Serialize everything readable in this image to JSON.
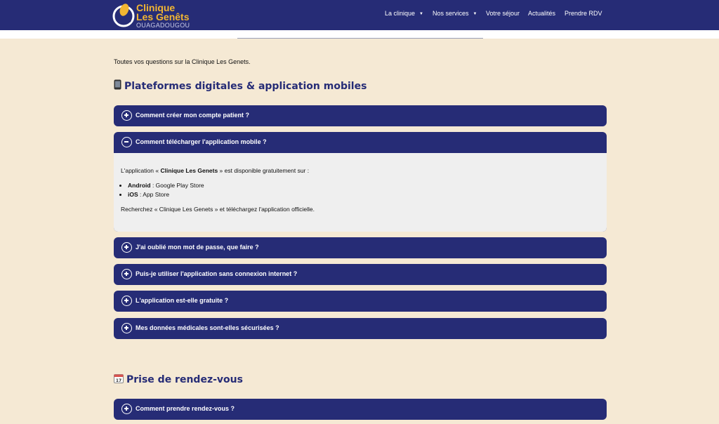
{
  "header": {
    "logo_line1": "Clinique",
    "logo_line2": "Les Genêts",
    "logo_line3": "OUAGADOUGOU",
    "nav": [
      {
        "label": "La clinique",
        "has_dropdown": true
      },
      {
        "label": "Nos services",
        "has_dropdown": true
      },
      {
        "label": "Votre séjour",
        "has_dropdown": false
      },
      {
        "label": "Actualités",
        "has_dropdown": false
      },
      {
        "label": "Prendre RDV",
        "has_dropdown": false
      }
    ]
  },
  "intro": "Toutes vos questions sur la Clinique Les Genets.",
  "sections": [
    {
      "icon": "mobile-phone-icon",
      "title": "Plateformes digitales & application mobiles",
      "items": [
        {
          "question": "Comment créer mon compte patient ?",
          "expanded": false
        },
        {
          "question": "Comment télécharger l'application mobile ?",
          "expanded": true,
          "answer": {
            "p1_pre": "L'application « ",
            "p1_bold": "Clinique Les Genets",
            "p1_post": " » est disponible gratuitement sur :",
            "list": [
              {
                "bold": "Android",
                "text": " : Google Play Store"
              },
              {
                "bold": "iOS",
                "text": " : App Store"
              }
            ],
            "p2": "Recherchez « Clinique Les Genets » et téléchargez l'application officielle."
          }
        },
        {
          "question": "J'ai oublié mon mot de passe, que faire ?",
          "expanded": false
        },
        {
          "question": "Puis-je utiliser l'application sans connexion internet ?",
          "expanded": false
        },
        {
          "question": "L'application est-elle gratuite ?",
          "expanded": false
        },
        {
          "question": "Mes données médicales sont-elles sécurisées ?",
          "expanded": false
        }
      ]
    },
    {
      "icon": "calendar-icon",
      "title": "Prise de rendez-vous",
      "items": [
        {
          "question": "Comment prendre rendez-vous ?",
          "expanded": false
        }
      ]
    }
  ],
  "colors": {
    "header_bg": "#262c76",
    "page_bg": "#f5e9d4",
    "accent_gold": "#f2b632",
    "answer_bg": "#efefef"
  }
}
